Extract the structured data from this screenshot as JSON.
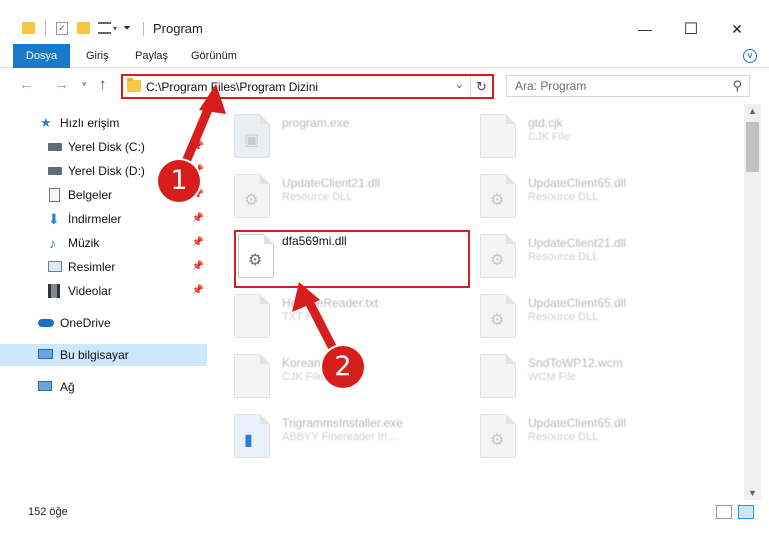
{
  "window": {
    "title": "Program",
    "minimize": "—",
    "maximize": "☐",
    "close": "✕"
  },
  "ribbon": {
    "tabs": [
      "Dosya",
      "Giriş",
      "Paylaş",
      "Görünüm"
    ]
  },
  "nav": {
    "path": "C:\\Program Files\\Program Dizini",
    "search_placeholder": "Ara: Program"
  },
  "sidebar": {
    "quick_access": "Hızlı erişim",
    "items": [
      {
        "label": "Yerel Disk (C:)",
        "icon": "drive-icon"
      },
      {
        "label": "Yerel Disk (D:)",
        "icon": "drive-icon"
      },
      {
        "label": "Belgeler",
        "icon": "documents-icon"
      },
      {
        "label": "İndirmeler",
        "icon": "downloads-icon"
      },
      {
        "label": "Müzik",
        "icon": "music-icon"
      },
      {
        "label": "Resimler",
        "icon": "pictures-icon"
      },
      {
        "label": "Videolar",
        "icon": "videos-icon"
      }
    ],
    "onedrive": "OneDrive",
    "this_pc": "Bu bilgisayar",
    "network": "Ağ"
  },
  "files": [
    {
      "name": "program.exe",
      "type": ""
    },
    {
      "name": "gtd.cjk",
      "type": "CJK File"
    },
    {
      "name": "UpdateClient21.dll",
      "type": "Resource DLL"
    },
    {
      "name": "UpdateClient65.dll",
      "type": "Resource DLL"
    },
    {
      "name": "dfa569mi.dll",
      "type": ""
    },
    {
      "name": "UpdateClient21.dll",
      "type": "Resource DLL"
    },
    {
      "name": "HelpmeReader.txt",
      "type": "TXT File"
    },
    {
      "name": "UpdateClient65.dll",
      "type": "Resource DLL"
    },
    {
      "name": "Korean",
      "type": "CJK File"
    },
    {
      "name": "SndToWP12.wcm",
      "type": "WCM File"
    },
    {
      "name": "TrigrammsInstaller.exe",
      "type": "ABBYY Finereader tri..."
    },
    {
      "name": "UpdateClient65.dll",
      "type": "Resource DLL"
    }
  ],
  "status": {
    "count": "152 öğe"
  },
  "annotations": {
    "step1": "1",
    "step2": "2",
    "color": "#d81d1d"
  }
}
